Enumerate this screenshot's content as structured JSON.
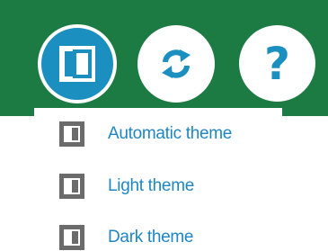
{
  "toolbar": {
    "buttons": [
      {
        "icon": "theme-icon",
        "active": true
      },
      {
        "icon": "refresh-icon",
        "active": false
      },
      {
        "icon": "help-icon",
        "active": false,
        "glyph": "?"
      }
    ]
  },
  "theme_menu": {
    "items": [
      {
        "label": "Automatic theme",
        "icon": "theme-icon"
      },
      {
        "label": "Light theme",
        "icon": "theme-icon"
      },
      {
        "label": "Dark theme",
        "icon": "theme-icon"
      }
    ]
  },
  "colors": {
    "toolbar_bg": "#1c7a43",
    "accent_blue": "#1b8fc0",
    "link_text": "#1f86c4",
    "icon_gray": "#6b6b6b"
  }
}
